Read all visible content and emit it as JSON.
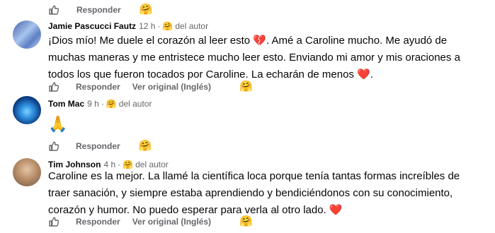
{
  "top_actions": {
    "reply": "Responder",
    "reaction_emoji": "🤗"
  },
  "comments": [
    {
      "author": "Jamie Pascucci Fautz",
      "time": "12 h",
      "separator": "·",
      "badge": "del autor",
      "badge_emoji": "🤗",
      "body": "¡Dios mío! Me duele el corazón al leer esto 💔. Amé a Caroline mucho. Me ayudó de muchas maneras y me entristece mucho leer esto. Enviando mi amor y mis oraciones a todos los que fueron tocados por Caroline. La echarán de menos ❤️.",
      "reply": "Responder",
      "translate": "Ver original (Inglés)",
      "reaction_emoji": "🤗",
      "avatar_colors": [
        "#4a6fb5",
        "#9fb9e6"
      ]
    },
    {
      "author": "Tom Mac",
      "time": "9 h",
      "separator": "·",
      "badge": "del autor",
      "badge_emoji": "🤗",
      "body": "🙏",
      "reply": "Responder",
      "reaction_emoji": "🤗",
      "avatar_colors": [
        "#0b3d7a",
        "#27a0e8"
      ]
    },
    {
      "author": "Tim Johnson",
      "time": "4 h",
      "separator": "·",
      "badge": "del autor",
      "badge_emoji": "🤗",
      "body": "Caroline es la mejor. La llamé la científica loca porque tenía tantas formas increíbles de traer sanación, y siempre estaba aprendiendo y bendiciéndonos con su conocimiento, corazón y humor. No puedo esperar para verla al otro lado. ❤️",
      "reply": "Responder",
      "translate": "Ver original (Inglés)",
      "reaction_emoji": "🤗",
      "avatar_colors": [
        "#8a6a4e",
        "#d7b897"
      ]
    }
  ]
}
